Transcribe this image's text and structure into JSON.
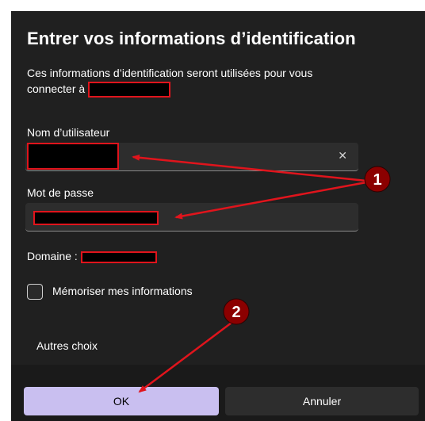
{
  "dialog": {
    "title": "Entrer vos informations d’identification",
    "description_line1": "Ces informations d’identification seront utilisées pour vous",
    "description_line2": "connecter à"
  },
  "username": {
    "label": "Nom d’utilisateur",
    "clear_glyph": "✕"
  },
  "password": {
    "label": "Mot de passe"
  },
  "domain": {
    "label": "Domaine :"
  },
  "remember": {
    "label": "Mémoriser mes informations",
    "checked": false
  },
  "other_choices": {
    "label": "Autres choix"
  },
  "buttons": {
    "ok": "OK",
    "cancel": "Annuler"
  },
  "annotations": {
    "badge1": "1",
    "badge2": "2",
    "arrow_color": "#e0141c",
    "badge_color": "#8b0000"
  },
  "colors": {
    "dialog_bg": "#202020",
    "field_bg": "#2d2d2d",
    "ok_accent": "#c9bff0",
    "redaction_border": "#e0141c"
  }
}
